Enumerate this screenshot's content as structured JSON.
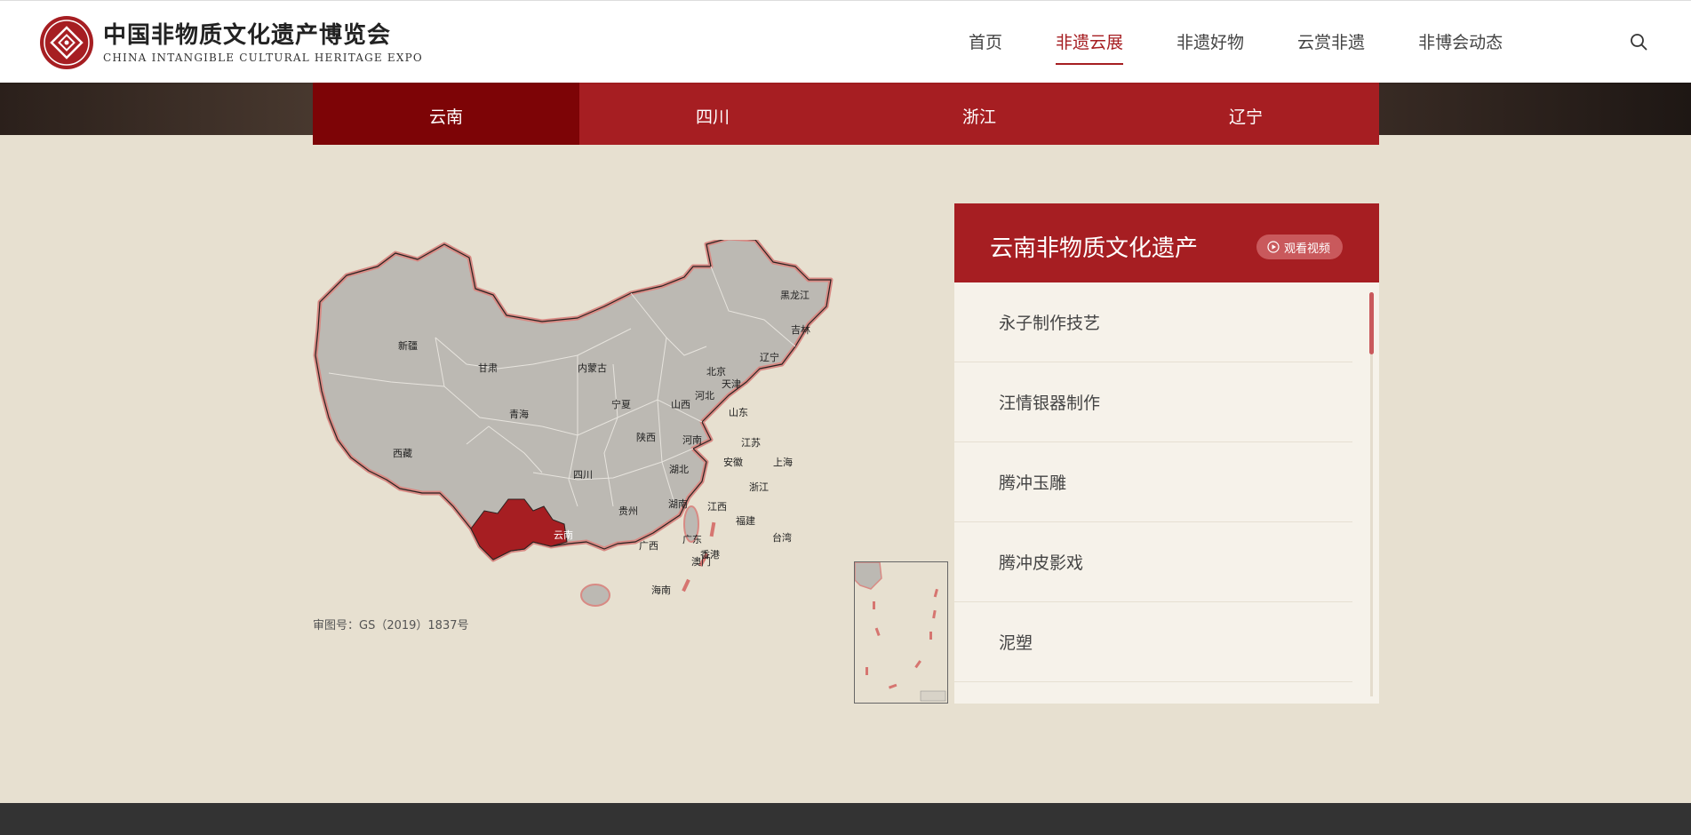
{
  "header": {
    "logo_cn": "中国非物质文化遗产博览会",
    "logo_en": "CHINA INTANGIBLE CULTURAL HERITAGE EXPO",
    "nav": [
      {
        "label": "首页",
        "active": false
      },
      {
        "label": "非遗云展",
        "active": true
      },
      {
        "label": "非遗好物",
        "active": false
      },
      {
        "label": "云赏非遗",
        "active": false
      },
      {
        "label": "非博会动态",
        "active": false
      }
    ]
  },
  "tabs": [
    {
      "label": "云南",
      "active": true
    },
    {
      "label": "四川",
      "active": false
    },
    {
      "label": "浙江",
      "active": false
    },
    {
      "label": "辽宁",
      "active": false
    }
  ],
  "map": {
    "highlighted": "云南",
    "approval_text": "审图号：GS（2019）1837号",
    "provinces": [
      "新疆",
      "甘肃",
      "内蒙古",
      "黑龙江",
      "吉林",
      "辽宁",
      "北京",
      "天津",
      "河北",
      "山西",
      "山东",
      "宁夏",
      "青海",
      "陕西",
      "河南",
      "江苏",
      "上海",
      "安徽",
      "湖北",
      "西藏",
      "四川",
      "浙江",
      "贵州",
      "湖南",
      "江西",
      "福建",
      "云南",
      "广西",
      "广东",
      "香港",
      "澳门",
      "台湾",
      "海南"
    ]
  },
  "panel": {
    "title": "云南非物质文化遗产",
    "video_button": "观看视频",
    "items": [
      "永子制作技艺",
      "汪情银器制作",
      "腾冲玉雕",
      "腾冲皮影戏",
      "泥塑"
    ]
  },
  "colors": {
    "brand_red": "#a61e22",
    "tab_active": "#7d0406",
    "paper": "#e7e0d0"
  }
}
